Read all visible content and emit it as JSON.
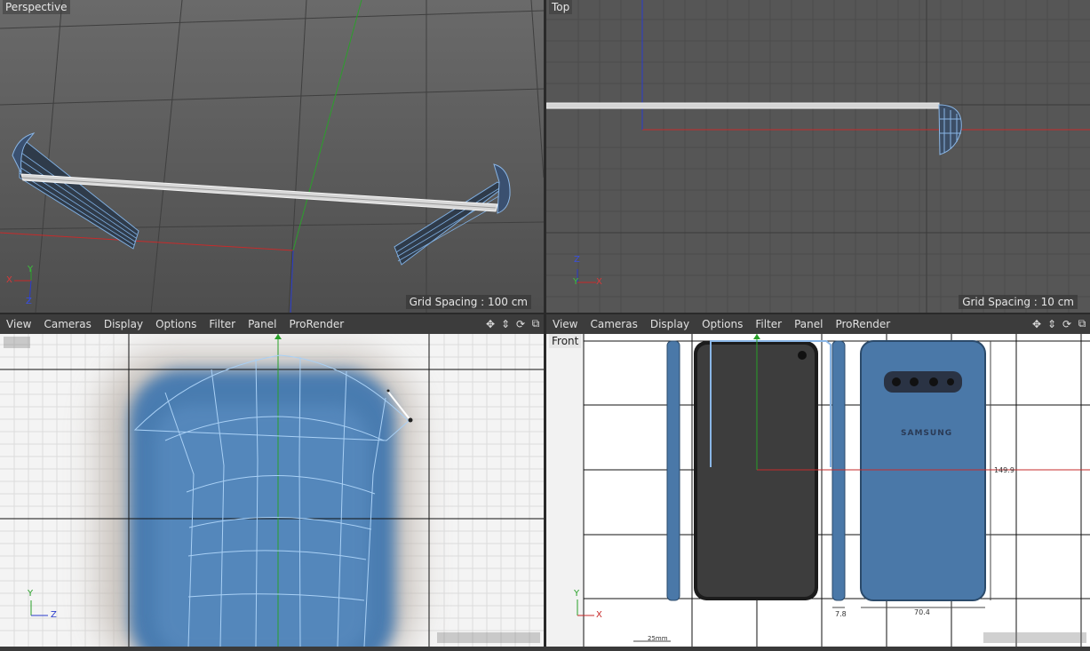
{
  "viewports": {
    "perspective": {
      "label": "Perspective",
      "grid_spacing": "Grid Spacing : 100 cm"
    },
    "top": {
      "label": "Top",
      "grid_spacing": "Grid Spacing : 10 cm"
    },
    "right": {
      "label": ""
    },
    "front": {
      "label": "Front"
    }
  },
  "menu": {
    "items": [
      "View",
      "Cameras",
      "Display",
      "Options",
      "Filter",
      "Panel",
      "ProRender"
    ]
  },
  "axes": {
    "x": "X",
    "y": "Y",
    "z": "Z"
  },
  "reference": {
    "brand": "SAMSUNG",
    "dim_height": "149.9",
    "dim_width": "70.4",
    "dim_depth": "7.8",
    "dim_scale": "25mm"
  },
  "colors": {
    "viewport_bg": "#5a5a5a",
    "menubar_bg": "#3c3c3c",
    "phone_blue": "#4a78a8",
    "wire": "#8ab6e6",
    "axis_x": "#c82828",
    "axis_y": "#2aa02a",
    "axis_z": "#2a3ccc"
  }
}
